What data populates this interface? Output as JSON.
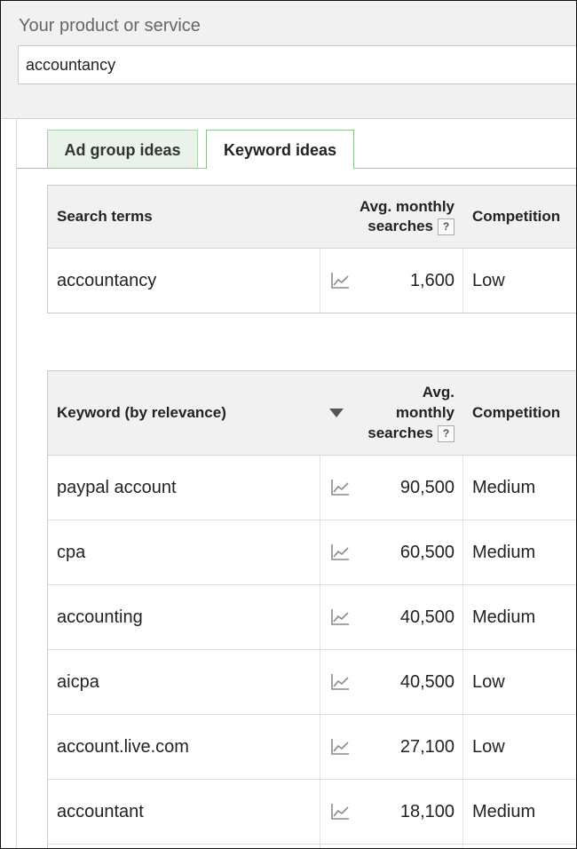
{
  "product": {
    "label": "Your product or service",
    "value": "accountancy"
  },
  "tabs": [
    {
      "label": "Ad group ideas",
      "active": false
    },
    {
      "label": "Keyword ideas",
      "active": true
    }
  ],
  "search_terms_table": {
    "headers": {
      "term": "Search terms",
      "avg_line1": "Avg. monthly",
      "avg_line2": "searches",
      "help": "?",
      "competition": "Competition"
    },
    "rows": [
      {
        "keyword": "accountancy",
        "searches": "1,600",
        "competition": "Low",
        "trend_icon": "line-chart-icon"
      }
    ]
  },
  "keyword_table": {
    "headers": {
      "keyword": "Keyword (by relevance)",
      "sort_icon": "sort-descending-icon",
      "avg_line1": "Avg.",
      "avg_line2": "monthly",
      "avg_line3": "searches",
      "help": "?",
      "competition": "Competition"
    },
    "rows": [
      {
        "keyword": "paypal account",
        "searches": "90,500",
        "competition": "Medium",
        "trend_icon": "line-chart-icon"
      },
      {
        "keyword": "cpa",
        "searches": "60,500",
        "competition": "Medium",
        "trend_icon": "line-chart-icon"
      },
      {
        "keyword": "accounting",
        "searches": "40,500",
        "competition": "Medium",
        "trend_icon": "line-chart-icon"
      },
      {
        "keyword": "aicpa",
        "searches": "40,500",
        "competition": "Low",
        "trend_icon": "line-chart-icon"
      },
      {
        "keyword": "account.live.com",
        "searches": "27,100",
        "competition": "Low",
        "trend_icon": "line-chart-icon"
      },
      {
        "keyword": "accountant",
        "searches": "18,100",
        "competition": "Medium",
        "trend_icon": "line-chart-icon"
      }
    ]
  },
  "colors": {
    "tab_border": "#a9d0a9",
    "header_bg": "#f1f1f1"
  }
}
